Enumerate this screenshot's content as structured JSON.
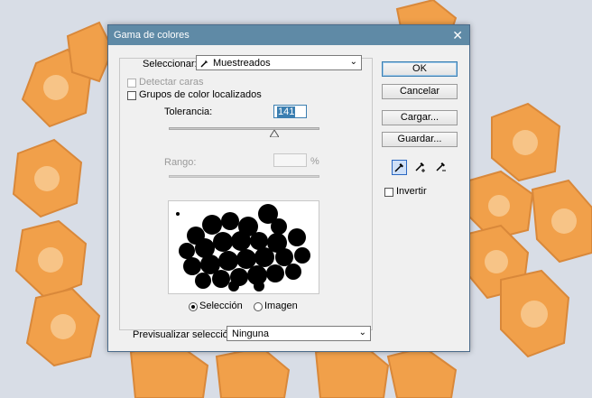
{
  "dialog": {
    "title": "Gama de colores",
    "close_glyph": "✕"
  },
  "select": {
    "label": "Seleccionar:",
    "value": "Muestreados",
    "icon": "eyedropper-icon"
  },
  "options": {
    "detect_faces": "Detectar caras",
    "localized_groups": "Grupos de color localizados"
  },
  "tolerance": {
    "label": "Tolerancia:",
    "value": "141",
    "level_fraction": 0.7
  },
  "range": {
    "label": "Rango:",
    "value": "",
    "unit": "%"
  },
  "preview_mode": {
    "selection_label": "Selección",
    "image_label": "Imagen",
    "selected": "Selección"
  },
  "preview_selection": {
    "label": "Previsualizar selección:",
    "value": "Ninguna"
  },
  "buttons": {
    "ok": "OK",
    "cancel": "Cancelar",
    "load": "Cargar...",
    "save": "Guardar..."
  },
  "eyedroppers": [
    "eyedropper-icon",
    "eyedropper-plus-icon",
    "eyedropper-minus-icon"
  ],
  "invert": {
    "label": "Invertir"
  },
  "colors": {
    "titlebar": "#5f8aa6",
    "carrot": "#f1a04a",
    "background": "#d8dde6"
  }
}
